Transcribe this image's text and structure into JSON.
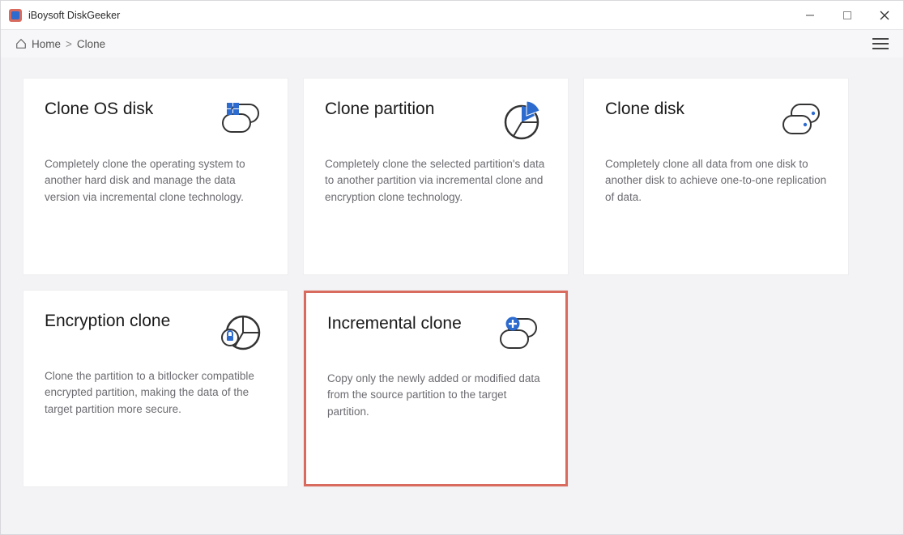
{
  "titlebar": {
    "title": "iBoysoft DiskGeeker"
  },
  "breadcrumb": {
    "home": "Home",
    "sep": ">",
    "current": "Clone"
  },
  "cards": [
    {
      "title": "Clone OS disk",
      "desc": "Completely clone the operating system to another hard disk and manage the data version via incremental clone technology."
    },
    {
      "title": "Clone partition",
      "desc": "Completely clone the selected partition's data to another partition via incremental clone and encryption clone technology."
    },
    {
      "title": "Clone disk",
      "desc": "Completely clone all data from one disk to another disk to achieve one-to-one replication of data."
    },
    {
      "title": "Encryption clone",
      "desc": "Clone the partition to a bitlocker compatible encrypted partition, making the data of the target partition more secure."
    },
    {
      "title": "Incremental clone",
      "desc": "Copy only the newly added or modified data from the source partition to the target partition."
    }
  ]
}
